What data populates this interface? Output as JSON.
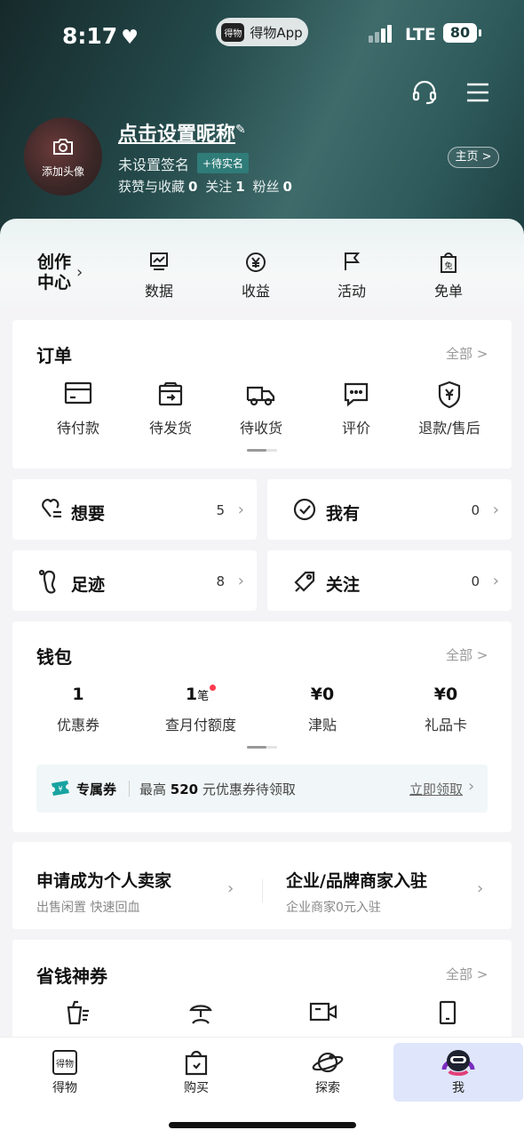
{
  "status_bar": {
    "time": "8:17",
    "pill_app": "得物App",
    "pill_logo": "得物",
    "network": "LTE",
    "battery": "80"
  },
  "profile": {
    "avatar_label": "添加头像",
    "nickname": "点击设置昵称",
    "signature": "未设置签名",
    "verify_label": "+待实名",
    "likes_label": "获赞与收藏",
    "likes": "0",
    "following_label": "关注",
    "following": "1",
    "fans_label": "粉丝",
    "fans": "0",
    "homepage_btn": "主页 >"
  },
  "creator": {
    "title_line1": "创作",
    "title_line2": "中心",
    "items": [
      {
        "label": "数据",
        "icon": "chart-icon"
      },
      {
        "label": "收益",
        "icon": "yen-coin-icon"
      },
      {
        "label": "活动",
        "icon": "flag-icon"
      },
      {
        "label": "免单",
        "icon": "free-bag-icon"
      }
    ]
  },
  "orders": {
    "title": "订单",
    "more": "全部 >",
    "items": [
      {
        "label": "待付款",
        "icon": "card-icon"
      },
      {
        "label": "待发货",
        "icon": "box-ship-icon"
      },
      {
        "label": "待收货",
        "icon": "truck-icon"
      },
      {
        "label": "评价",
        "icon": "comment-icon"
      },
      {
        "label": "退款/售后",
        "icon": "shield-yen-icon"
      }
    ]
  },
  "quick": [
    {
      "label": "想要",
      "count": "5",
      "icon": "heart-list-icon"
    },
    {
      "label": "我有",
      "count": "0",
      "icon": "check-circle-icon"
    },
    {
      "label": "足迹",
      "count": "8",
      "icon": "footprint-icon"
    },
    {
      "label": "关注",
      "count": "0",
      "icon": "tag-icon"
    }
  ],
  "wallet": {
    "title": "钱包",
    "more": "全部 >",
    "items": [
      {
        "value": "1",
        "unit": "",
        "label": "优惠券"
      },
      {
        "value": "1",
        "unit": "笔",
        "label": "查月付额度"
      },
      {
        "value": "¥0",
        "unit": "",
        "label": "津贴"
      },
      {
        "value": "¥0",
        "unit": "",
        "label": "礼品卡"
      }
    ],
    "coupon": {
      "tag": "专属券",
      "text_pre": "最高",
      "amount": "520",
      "text_post": "元优惠券待领取",
      "action": "立即领取"
    }
  },
  "seller": [
    {
      "title": "申请成为个人卖家",
      "subtitle": "出售闲置 快速回血"
    },
    {
      "title": "企业/品牌商家入驻",
      "subtitle": "企业商家0元入驻"
    }
  ],
  "saver": {
    "title": "省钱神券",
    "more": "全部 >",
    "icons": [
      "drink-icon",
      "beach-icon",
      "video-camera-icon",
      "phone-icon"
    ]
  },
  "tabbar": [
    {
      "label": "得物",
      "icon": "dewu-logo-icon"
    },
    {
      "label": "购买",
      "icon": "shopping-bag-icon"
    },
    {
      "label": "探索",
      "icon": "planet-icon"
    },
    {
      "label": "我",
      "icon": "mascot-icon",
      "active": true
    }
  ],
  "colors": {
    "accent": "#2f7c79",
    "reddot": "#ff3b4e",
    "tab_active_bg": "#dfe6fb"
  }
}
